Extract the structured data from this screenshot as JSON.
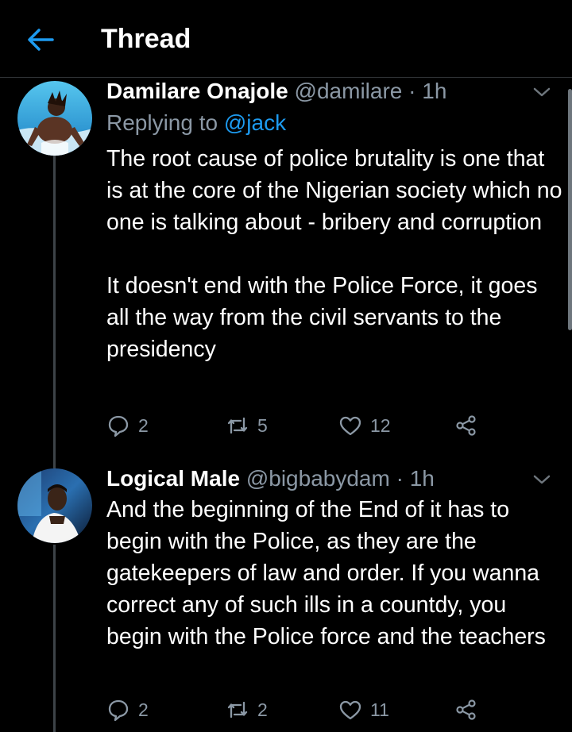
{
  "header": {
    "title": "Thread"
  },
  "tweets": [
    {
      "name": "Damilare Onajole",
      "handle": "@damilare",
      "separator": " · ",
      "time": "1h",
      "replying_prefix": "Replying to ",
      "replying_to": "@jack",
      "paragraphs": [
        "The root cause of police brutality is one that is at the core of the Nigerian society which no one is talking about - bribery and corruption",
        "It doesn't end with the Police Force, it goes all the way from the civil servants to the presidency"
      ],
      "reply_count": "2",
      "retweet_count": "5",
      "like_count": "12"
    },
    {
      "name": "Logical Male",
      "handle": "@bigbabydam",
      "separator": " · ",
      "time": "1h",
      "paragraphs": [
        "And the beginning of the End of it has to begin with the Police, as they are the gatekeepers of law and order. If you wanna correct any of such ills in a countdy, you begin with the Police force and the teachers"
      ],
      "reply_count": "2",
      "retweet_count": "2",
      "like_count": "11"
    }
  ],
  "icons": {
    "back": "back-arrow-icon",
    "caret": "chevron-down-icon",
    "reply": "reply-icon",
    "retweet": "retweet-icon",
    "like": "heart-icon",
    "share": "share-icon"
  },
  "colors": {
    "background": "#000000",
    "accent": "#1d9bf0",
    "secondary_text": "#8b98a5",
    "divider": "#2f3336"
  }
}
